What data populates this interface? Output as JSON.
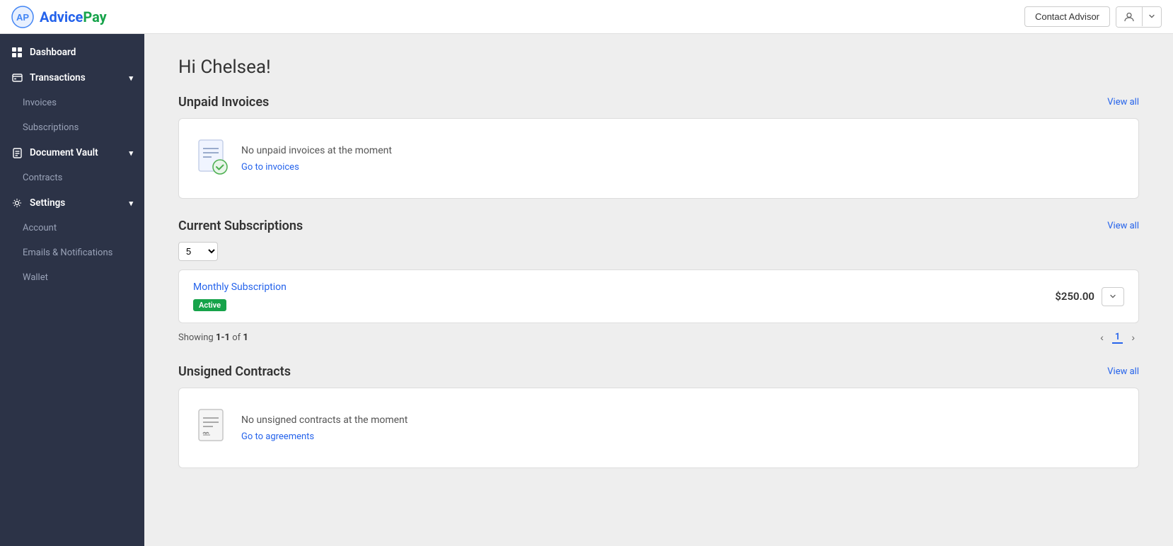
{
  "header": {
    "logo_text": "AdvicePay",
    "contact_advisor_label": "Contact Advisor"
  },
  "sidebar": {
    "items": [
      {
        "id": "dashboard",
        "label": "Dashboard",
        "level": "parent",
        "icon": "grid"
      },
      {
        "id": "transactions",
        "label": "Transactions",
        "level": "parent",
        "icon": "credit-card",
        "expanded": true
      },
      {
        "id": "invoices",
        "label": "Invoices",
        "level": "child"
      },
      {
        "id": "subscriptions",
        "label": "Subscriptions",
        "level": "child"
      },
      {
        "id": "document-vault",
        "label": "Document Vault",
        "level": "parent",
        "icon": "file",
        "expanded": true
      },
      {
        "id": "contracts",
        "label": "Contracts",
        "level": "child"
      },
      {
        "id": "settings",
        "label": "Settings",
        "level": "parent",
        "icon": "gear",
        "expanded": true
      },
      {
        "id": "account",
        "label": "Account",
        "level": "child"
      },
      {
        "id": "emails-notifications",
        "label": "Emails & Notifications",
        "level": "child"
      },
      {
        "id": "wallet",
        "label": "Wallet",
        "level": "child"
      }
    ]
  },
  "main": {
    "greeting": "Hi Chelsea!",
    "sections": {
      "unpaid_invoices": {
        "title": "Unpaid Invoices",
        "view_all": "View all",
        "empty_text": "No unpaid invoices at the moment",
        "empty_link": "Go to invoices"
      },
      "current_subscriptions": {
        "title": "Current Subscriptions",
        "view_all": "View all",
        "per_page_value": "5",
        "subscription": {
          "name": "Monthly Subscription",
          "status": "Active",
          "amount": "$250.00"
        },
        "showing_text": "Showing ",
        "showing_range": "1-1",
        "showing_of": " of ",
        "showing_total": "1",
        "current_page": "1"
      },
      "unsigned_contracts": {
        "title": "Unsigned Contracts",
        "view_all": "View all",
        "empty_text": "No unsigned contracts at the moment",
        "empty_link": "Go to agreements"
      }
    }
  }
}
